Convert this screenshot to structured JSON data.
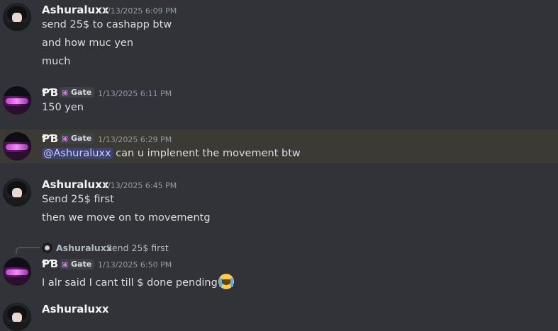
{
  "messages": [
    {
      "author": "Ashuraluxx",
      "timestamp": "1/13/2025 6:09 PM",
      "lines": [
        "send 25$ to cashapp btw",
        "and how muc yen",
        "much"
      ]
    },
    {
      "author": "ⱣƁ",
      "tag": "Gate",
      "timestamp": "1/13/2025 6:11 PM",
      "lines": [
        "150 yen"
      ]
    },
    {
      "author": "ⱣƁ",
      "tag": "Gate",
      "timestamp": "1/13/2025 6:29 PM",
      "mention": "@Ashuraluxx",
      "text": " can u implenent the movement btw"
    },
    {
      "author": "Ashuraluxx",
      "timestamp": "1/13/2025 6:45 PM",
      "lines": [
        "Send 25$ first",
        "then we move on to movementg"
      ]
    },
    {
      "reply": {
        "author": "Ashuraluxx",
        "text": "Send 25$ first"
      },
      "author": "ⱣƁ",
      "tag": "Gate",
      "timestamp": "1/13/2025 6:50 PM",
      "text": "I alr said I cant till $ done pending",
      "emoji": "sob-emoji"
    },
    {
      "author": "Ashuraluxx"
    }
  ],
  "colors": {
    "background": "#313338",
    "highlight": "#3c3a34",
    "mention_bg": "#3e4270",
    "mention_fg": "#c9cdfb"
  }
}
